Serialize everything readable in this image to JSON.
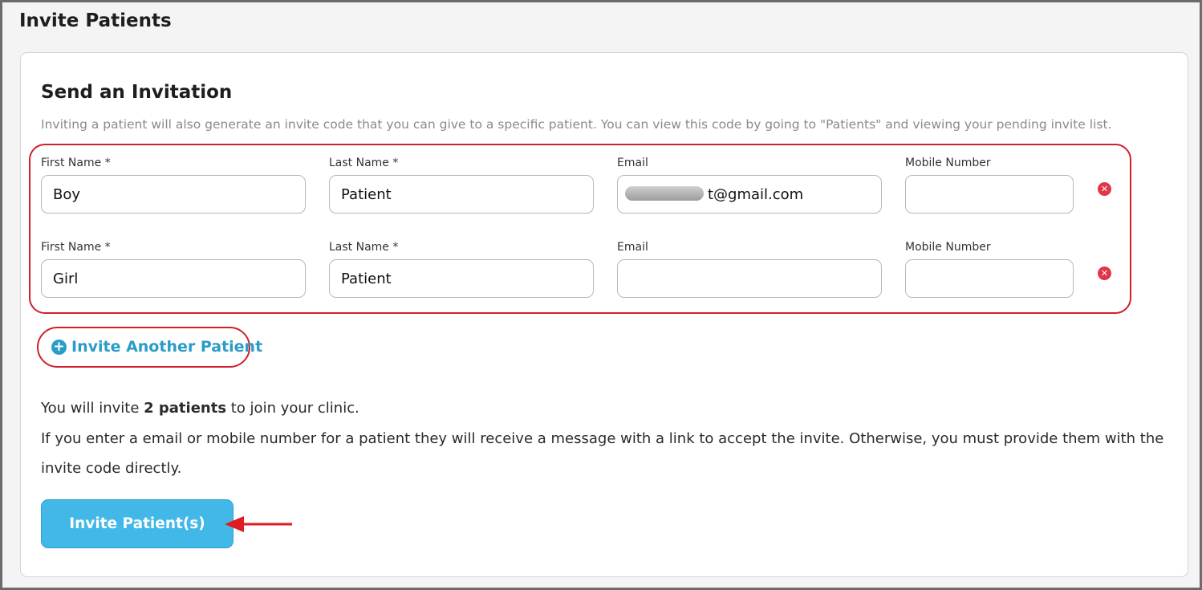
{
  "page": {
    "title": "Invite Patients"
  },
  "card": {
    "title": "Send an Invitation",
    "description": "Inviting a patient will also generate an invite code that you can give to a specific patient. You can view this code by going to \"Patients\" and viewing your pending invite list."
  },
  "labels": {
    "first_name": "First Name *",
    "last_name": "Last Name *",
    "email": "Email",
    "mobile": "Mobile Number"
  },
  "rows": [
    {
      "first_name": "Boy",
      "last_name": "Patient",
      "email": "t@gmail.com",
      "mobile": ""
    },
    {
      "first_name": "Girl",
      "last_name": "Patient",
      "email": "",
      "mobile": ""
    }
  ],
  "actions": {
    "invite_another": "Invite Another Patient",
    "submit": "Invite Patient(s)"
  },
  "summary": {
    "prefix": "You will invite ",
    "count": "2 patients",
    "suffix": " to join your clinic.",
    "line2": "If you enter a email or mobile number for a patient they will receive a message with a link to accept the invite. Otherwise, you must provide them with the",
    "line3": "invite code directly."
  },
  "icons": {
    "remove": "close-circle-icon",
    "add": "plus-circle-icon",
    "pointer": "red-arrow-icon"
  },
  "colors": {
    "accent": "#2b9bc7",
    "button": "#41b8e8",
    "highlight": "#d11f2c",
    "remove": "#e3354a"
  }
}
